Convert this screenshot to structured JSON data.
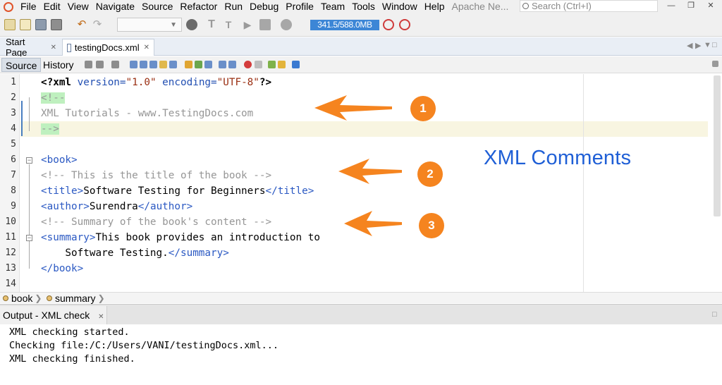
{
  "menubar": {
    "items": [
      "File",
      "Edit",
      "View",
      "Navigate",
      "Source",
      "Refactor",
      "Run",
      "Debug",
      "Profile",
      "Team",
      "Tools",
      "Window",
      "Help"
    ],
    "app_name": "Apache Ne...",
    "search_placeholder": "Search (Ctrl+I)"
  },
  "toolbar": {
    "memory": "341.5/588.0MB",
    "icons": [
      "new-project-icon",
      "new-file-icon",
      "open-project-icon",
      "save-all-icon",
      "undo-icon",
      "redo-icon",
      "config-combo",
      "globe-icon",
      "hammer-icon",
      "clean-build-icon",
      "run-icon",
      "debug-icon",
      "profile-icon",
      "gc-icon",
      "gc-reset-icon"
    ]
  },
  "editor_tabs": {
    "tabs": [
      {
        "label": "Start Page"
      },
      {
        "label": "testingDocs.xml"
      }
    ]
  },
  "editor_subtabs": {
    "source": "Source",
    "history": "History"
  },
  "code_lines": [
    {
      "num": "1"
    },
    {
      "num": "2"
    },
    {
      "num": "3"
    },
    {
      "num": "4"
    },
    {
      "num": "5"
    },
    {
      "num": "6"
    },
    {
      "num": "7"
    },
    {
      "num": "8"
    },
    {
      "num": "9"
    },
    {
      "num": "10"
    },
    {
      "num": "11"
    },
    {
      "num": "12"
    },
    {
      "num": "13"
    },
    {
      "num": "14"
    }
  ],
  "code": {
    "l1_decl_open": "<?xml",
    "l1_attr1": " version=",
    "l1_val1": "\"1.0\"",
    "l1_attr2": " encoding=",
    "l1_val2": "\"UTF-8\"",
    "l1_decl_close": "?>",
    "l2": "<!--",
    "l3": "XML Tutorials - www.TestingDocs.com",
    "l4": "-->",
    "l6": "<book>",
    "l7": "<!-- This is the title of the book -->",
    "l8_open": "<title>",
    "l8_text": "Software Testing for Beginners",
    "l8_close": "</title>",
    "l9_open": "<author>",
    "l9_text": "Surendra",
    "l9_close": "</author>",
    "l10": "<!-- Summary of the book's content -->",
    "l11_open": "<summary>",
    "l11_text": "This book provides an introduction to",
    "l12_text": "    Software Testing.",
    "l12_close": "</summary>",
    "l13": "</book>"
  },
  "annotations": {
    "badges": [
      "1",
      "2",
      "3"
    ],
    "title": "XML Comments",
    "accent": "#f5841f",
    "title_color": "#1f5fd6"
  },
  "breadcrumb": {
    "items": [
      "book",
      "summary"
    ]
  },
  "output": {
    "tab_label": "Output - XML check",
    "lines": [
      "XML checking started.",
      "Checking file:/C:/Users/VANI/testingDocs.xml...",
      "XML checking finished."
    ]
  }
}
